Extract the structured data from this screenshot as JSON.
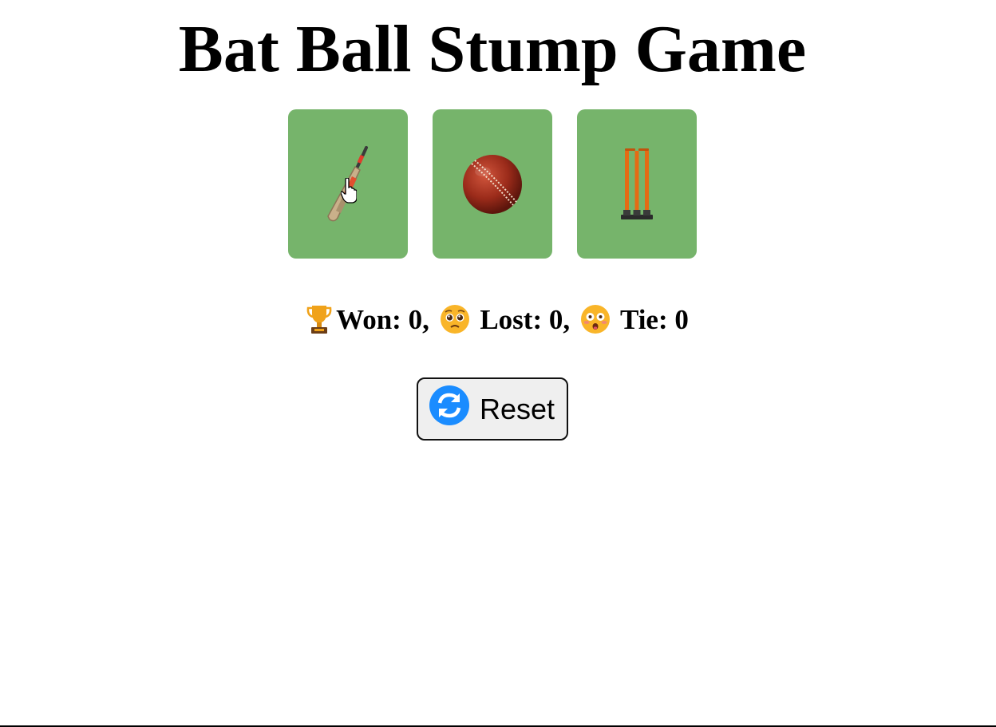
{
  "page": {
    "title": "Bat Ball Stump Game"
  },
  "choices": [
    {
      "name": "Bat",
      "icon": "cricket-bat-icon"
    },
    {
      "name": "Ball",
      "icon": "cricket-ball-icon"
    },
    {
      "name": "Stump",
      "icon": "cricket-stumps-icon"
    }
  ],
  "score": {
    "won_label": "Won: 0,",
    "lost_label": "Lost: 0,",
    "tie_label": "Tie: 0",
    "won_icon": "trophy-icon",
    "lost_icon": "pleading-face-icon",
    "tie_icon": "flushed-face-icon"
  },
  "reset": {
    "label": "Reset",
    "icon": "refresh-icon"
  },
  "colors": {
    "card": "#76b46b",
    "reset_icon": "#1a8cff",
    "button_bg": "#efefef"
  }
}
